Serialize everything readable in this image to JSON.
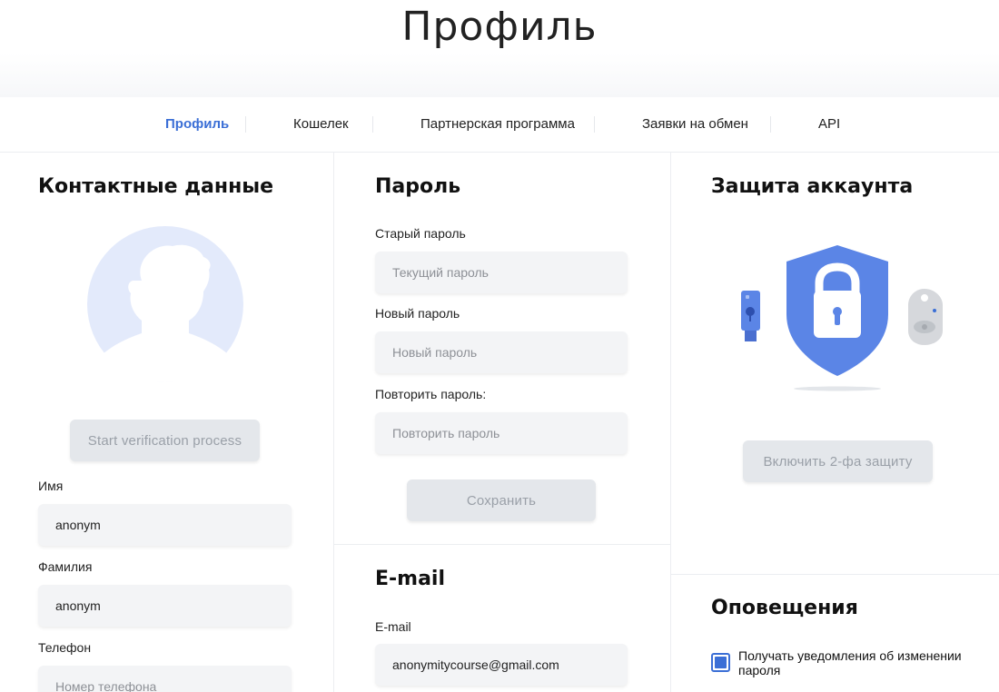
{
  "header": {
    "title": "Профиль"
  },
  "tabs": [
    {
      "label": "Профиль",
      "active": true
    },
    {
      "label": "Кошелек",
      "active": false
    },
    {
      "label": "Партнерская программа",
      "active": false
    },
    {
      "label": "Заявки на обмен",
      "active": false
    },
    {
      "label": "API",
      "active": false
    }
  ],
  "contacts": {
    "title": "Контактные данные",
    "verify_button": "Start verification process",
    "first_name_label": "Имя",
    "first_name_value": "anonym",
    "last_name_label": "Фамилия",
    "last_name_value": "anonym",
    "phone_label": "Телефон",
    "phone_placeholder": "Номер телефона"
  },
  "password": {
    "title": "Пароль",
    "old_label": "Старый пароль",
    "old_placeholder": "Текущий пароль",
    "new_label": "Новый пароль",
    "new_placeholder": "Новый пароль",
    "repeat_label": "Повторить пароль:",
    "repeat_placeholder": "Повторить пароль",
    "save_button": "Сохранить"
  },
  "email": {
    "title": "E-mail",
    "label": "E-mail",
    "value": "anonymitycourse@gmail.com"
  },
  "security": {
    "title": "Защита аккаунта",
    "enable_2fa_button": "Включить 2-фа защиту"
  },
  "notifications": {
    "title": "Оповещения",
    "password_change_label": "Получать уведомления об изменении пароля",
    "password_change_checked": true
  },
  "colors": {
    "accent": "#3b6fd6",
    "shield": "#5b85e6",
    "avatar_bg": "#e3eafb",
    "input_bg": "#f3f4f6",
    "button_bg": "#e4e7eb"
  }
}
